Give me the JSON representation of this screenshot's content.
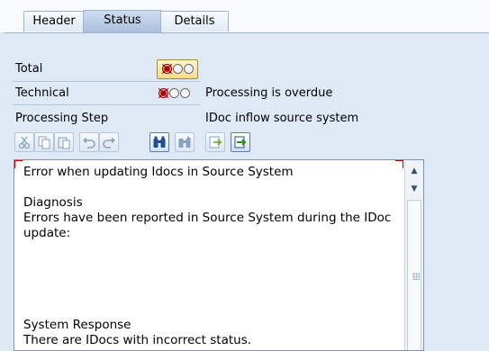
{
  "tabs": [
    {
      "label": "Header",
      "active": false
    },
    {
      "label": "Status",
      "active": true
    },
    {
      "label": "Details",
      "active": false
    }
  ],
  "status_rows": {
    "total_label": "Total",
    "technical_label": "Technical",
    "technical_value": "Processing is overdue",
    "processing_step_label": "Processing Step",
    "processing_step_value": "IDoc inflow source system"
  },
  "status_lights": {
    "total": "red",
    "technical": "red",
    "red_color": "#e00000"
  },
  "toolbar": {
    "buttons": [
      "cut-icon",
      "copy-icon",
      "paste-icon",
      "undo-icon",
      "redo-icon",
      "find-icon",
      "find-next-icon",
      "save-local-icon",
      "load-local-icon"
    ]
  },
  "message": {
    "text": "Error when updating Idocs in Source System\n\nDiagnosis\nErrors have been reported in Source System during the IDoc update:\n\n\n\n\n\nSystem Response\nThere are IDocs with incorrect status."
  }
}
